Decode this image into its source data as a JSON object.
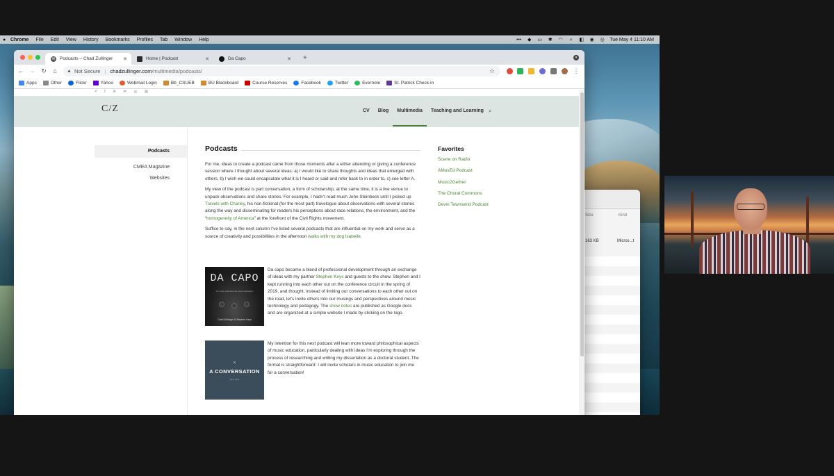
{
  "menubar": {
    "app": "Chrome",
    "items": [
      "File",
      "Edit",
      "View",
      "History",
      "Bookmarks",
      "Profiles",
      "Tab",
      "Window",
      "Help"
    ],
    "datetime": "Tue May 4  11:10 AM"
  },
  "tabs": [
    {
      "title": "Podcasts – Chad Zullinger",
      "active": true,
      "favicon": "wordpress-icon"
    },
    {
      "title": "Home | Podcast",
      "active": false,
      "favicon": "site-icon"
    },
    {
      "title": "Da Capo",
      "active": false,
      "favicon": "dacapo-icon"
    }
  ],
  "omnibox": {
    "security": "Not Secure",
    "host": "chadzullinger.com",
    "path": "/multimedia/podcasts/"
  },
  "bookmarks": [
    "Apps",
    "Other",
    "Flickr",
    "Yahoo",
    "Webmail Login",
    "Bb_CSUEB",
    "BU Blackboard",
    "Course Reserves",
    "Facebook",
    "Twitter",
    "Evernote",
    "St. Patrick Check-in"
  ],
  "site": {
    "logo": "C/Z",
    "nav": [
      "CV",
      "Blog",
      "Multimedia",
      "Teaching and Learning"
    ],
    "active_nav": "Multimedia"
  },
  "subnav": [
    "Podcasts",
    "CMEA Magazine",
    "Websites"
  ],
  "content": {
    "title": "Podcasts",
    "p1": "For me, ideas to create a podcast came from those moments after a either attending or giving a conference session where I thought about several ideas: a) I would like to share thoughts and ideas that emerged with others, b) I wish we could encapsulate what it is I heard or said and refer back to in order to, c) see letter A.",
    "p2_a": "My view of the podcast is part conversation, a form of scholarship, at the same time, it is a live venue to unpack observations and share stories. For example, I hadn’t read much John Steinbeck until I picked up ",
    "p2_link1": "Travels with Charley",
    "p2_b": ", his non-fictional (for the most part) travelogue about observations with several stories along the way and disseminating for readers his perceptions about race relations, the environment, and the “",
    "p2_link2": "homogeneity of America",
    "p2_c": "” at the forefront of the Civil Rights movement.",
    "p3_a": "Suffice to say, in the next column I’ve listed several podcasts that are influential on my work and serve as a source of creativity and possibilities in the afternoon ",
    "p3_link": "walks with my dog Isabelle",
    "p3_b": "."
  },
  "podcast1": {
    "cover_title": "DA CAPO",
    "cover_subtitle": "for music educators by music educators",
    "cover_by": "Chad Zullinger & Stephen Keys",
    "text_a": "Da capo became a blend of professional development through an exchange of ideas with my partner ",
    "link1": "Stephen Keys",
    "text_b": " and guests to the show. Stephen and I kept running into each other out on the conference circuit in the spring of 2019, and thought, instead of limiting our conversations to each other out on the road, let’s invite others into our musings and perspectives around music technology and pedagogy. The ",
    "link2": "show notes",
    "text_c": " are published as Google docs and are organized at a simple website I made by clicking on the logo."
  },
  "podcast2": {
    "cover_mark": "×",
    "cover_title": "A CONVERSATION",
    "cover_sub": "EST. 2021",
    "text": "My intention for this next podcast will lean more toward philosophical aspects of music education, particularly dealing with ideas I’m exploring through the process of researching and writing my dissertation as a doctoral student. The format is straightforward: I will invite scholars in music education to join me for a conversation!"
  },
  "favorites": {
    "title": "Favorites",
    "items": [
      "Scene on Radio",
      "AMusEd Podcast",
      "Music2Gether",
      "The Choral Commons",
      "Devin Townsend Podcast"
    ]
  },
  "finder": {
    "col_size": "Size",
    "col_kind": "Kind",
    "row_size": "163 KB",
    "row_kind": "Micros...t"
  },
  "colors": {
    "link": "#4d7f35",
    "header_bg": "#dde5e3"
  }
}
